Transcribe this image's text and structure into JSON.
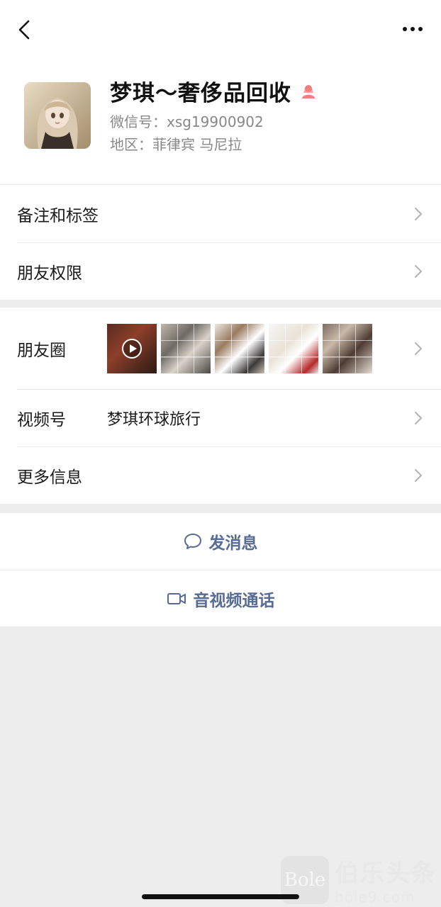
{
  "profile": {
    "name": "梦琪～奢侈品回收",
    "wechat_id": "微信号：xsg19900902",
    "region": "地区：菲律宾 马尼拉",
    "gender": "female-icon"
  },
  "rows": {
    "remarks_tags": "备注和标签",
    "friend_permissions": "朋友权限",
    "moments": "朋友圈",
    "channels": "视频号",
    "channels_value": "梦琪环球旅行",
    "more_info": "更多信息"
  },
  "actions": {
    "send_message": "发消息",
    "video_call": "音视频通话"
  },
  "watermark": {
    "logo": "Bole",
    "name": "伯乐头条",
    "url": "bole9.com"
  },
  "colors": {
    "link": "#576b95",
    "gender_female": "#f37e7d"
  }
}
